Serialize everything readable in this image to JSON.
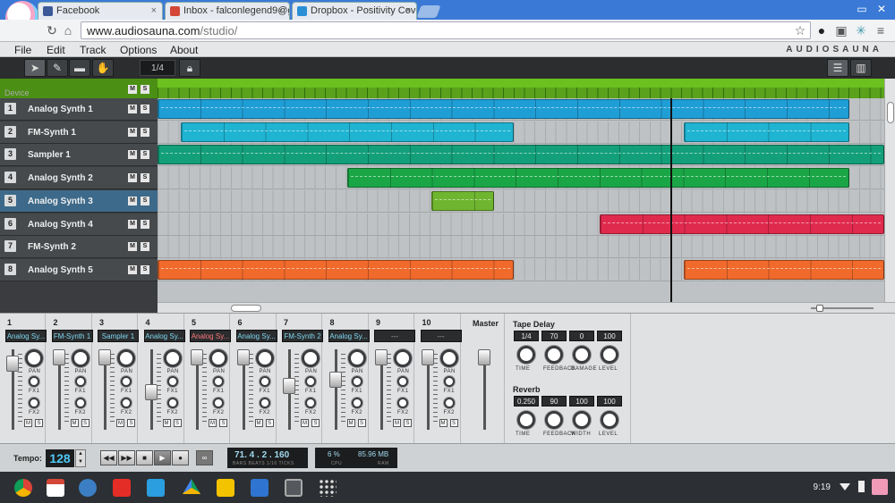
{
  "browser": {
    "tabs": [
      {
        "title": "Facebook",
        "color": "#3b5998"
      },
      {
        "title": "Inbox - falconlegend9@g",
        "color": "#d44638"
      },
      {
        "title": "Dropbox - Positivity Cove",
        "color": "#2b8fd6"
      }
    ],
    "url_host": "www.audiosauna.com",
    "url_path": "/studio/"
  },
  "menu": {
    "items": [
      "File",
      "Edit",
      "Track",
      "Options",
      "About"
    ],
    "brand": "AUDIOSAUNA"
  },
  "toolbar": {
    "quantize": "1/4"
  },
  "arrangement": {
    "ruler_label": "Device",
    "tracks": [
      {
        "num": "1",
        "name": "Analog Synth 1",
        "color": "#1f9ed6",
        "clips": [
          [
            0,
            773
          ]
        ]
      },
      {
        "num": "2",
        "name": "FM-Synth 1",
        "color": "#1fb4d2",
        "clips": [
          [
            26,
            398
          ],
          [
            588,
            773
          ]
        ]
      },
      {
        "num": "3",
        "name": "Sampler 1",
        "color": "#139f7a",
        "clips": [
          [
            0,
            812
          ]
        ]
      },
      {
        "num": "4",
        "name": "Analog Synth 2",
        "color": "#1aa646",
        "clips": [
          [
            212,
            773
          ]
        ]
      },
      {
        "num": "5",
        "name": "Analog Synth 3",
        "color": "#6fb52f",
        "clips": [
          [
            306,
            376
          ]
        ],
        "selected": true
      },
      {
        "num": "6",
        "name": "Analog Synth 4",
        "color": "#e02a4d",
        "clips": [
          [
            494,
            812
          ]
        ]
      },
      {
        "num": "7",
        "name": "FM-Synth 2",
        "color": "#999999",
        "clips": []
      },
      {
        "num": "8",
        "name": "Analog Synth 5",
        "color": "#f06a2c",
        "clips": [
          [
            0,
            398
          ],
          [
            588,
            812
          ]
        ]
      }
    ],
    "m_label": "M",
    "s_label": "S"
  },
  "mixer": {
    "channels": [
      {
        "num": "1",
        "name": "Analog Sy...",
        "fader": 0.1
      },
      {
        "num": "2",
        "name": "FM-Synth 1",
        "fader": 0.0
      },
      {
        "num": "3",
        "name": "Sampler 1",
        "fader": 0.0
      },
      {
        "num": "4",
        "name": "Analog Sy...",
        "fader": 0.55
      },
      {
        "num": "5",
        "name": "Analog Sy...",
        "fader": 0.0,
        "red": true
      },
      {
        "num": "6",
        "name": "Analog Sy...",
        "fader": 0.0
      },
      {
        "num": "7",
        "name": "FM-Synth 2",
        "fader": 0.45
      },
      {
        "num": "8",
        "name": "Analog Sy...",
        "fader": 0.35
      },
      {
        "num": "9",
        "name": "---",
        "fader": 0.0
      },
      {
        "num": "10",
        "name": "---",
        "fader": 0.0
      }
    ],
    "pan_label": "PAN",
    "fx1_label": "FX1",
    "fx2_label": "FX2",
    "master_label": "Master",
    "tape_delay": {
      "title": "Tape Delay",
      "values": [
        "1/4",
        "70",
        "0",
        "100"
      ],
      "labels": [
        "TIME",
        "FEEDBACK",
        "DAMAGE",
        "LEVEL"
      ]
    },
    "reverb": {
      "title": "Reverb",
      "values": [
        "0.250",
        "90",
        "100",
        "100"
      ],
      "labels": [
        "TIME",
        "FEEDBACK",
        "WIDTH",
        "LEVEL"
      ]
    }
  },
  "transport": {
    "tempo_label": "Tempo:",
    "tempo": "128",
    "position": "71. 4 . 2 . 160",
    "position_sub": "BARS BEATS 1/16 TICKS",
    "cpu": "6 %",
    "ram": "85.96 MB",
    "cpu_label": "CPU",
    "ram_label": "RAM"
  },
  "taskbar": {
    "clock": "9:19"
  }
}
